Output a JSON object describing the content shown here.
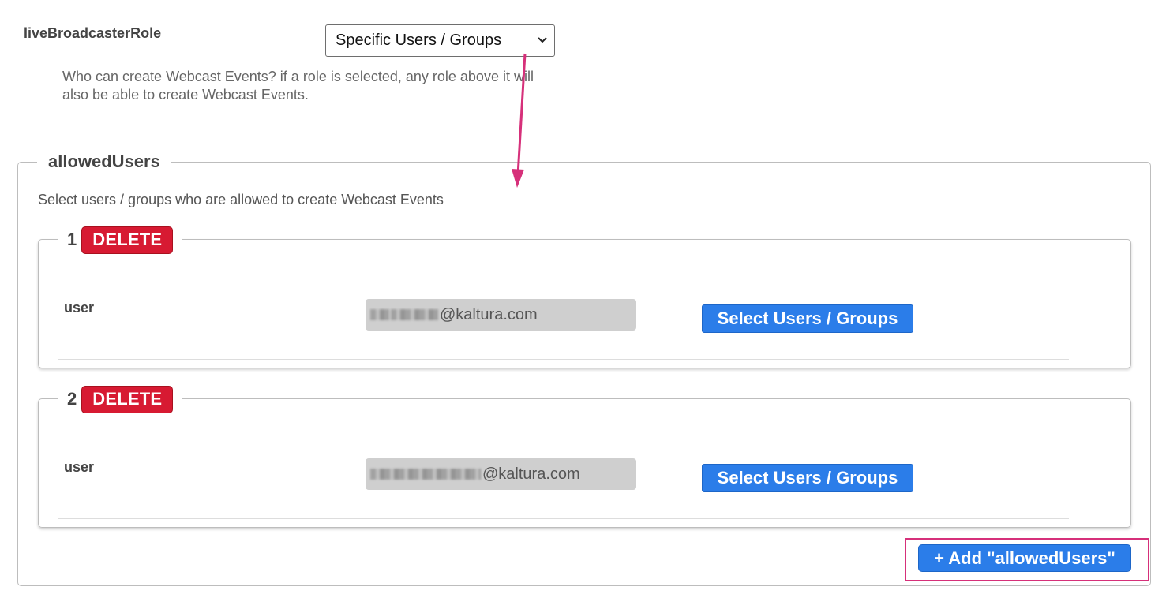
{
  "top_setting": {
    "label": "liveBroadcasterRole",
    "select_value": "Specific Users / Groups",
    "help_line1": "Who can create Webcast Events? if a role is selected, any role above it will",
    "help_line2": "also be able to create Webcast Events."
  },
  "allowed_users": {
    "legend": "allowedUsers",
    "description": "Select users / groups who are allowed to create Webcast Events",
    "items": [
      {
        "index": "1",
        "delete_label": "DELETE",
        "field_label": "user",
        "value_suffix": "@kaltura.com",
        "select_label": "Select Users / Groups"
      },
      {
        "index": "2",
        "delete_label": "DELETE",
        "field_label": "user",
        "value_suffix": "@kaltura.com",
        "select_label": "Select Users / Groups"
      }
    ],
    "add_label": "+ Add \"allowedUsers\""
  },
  "icons": {
    "select_chevron": "chevron-down-icon",
    "annotation": "arrow-annotation"
  },
  "colors": {
    "delete": "#d71a32",
    "primary": "#2b7de9",
    "annotation": "#d6307a"
  }
}
